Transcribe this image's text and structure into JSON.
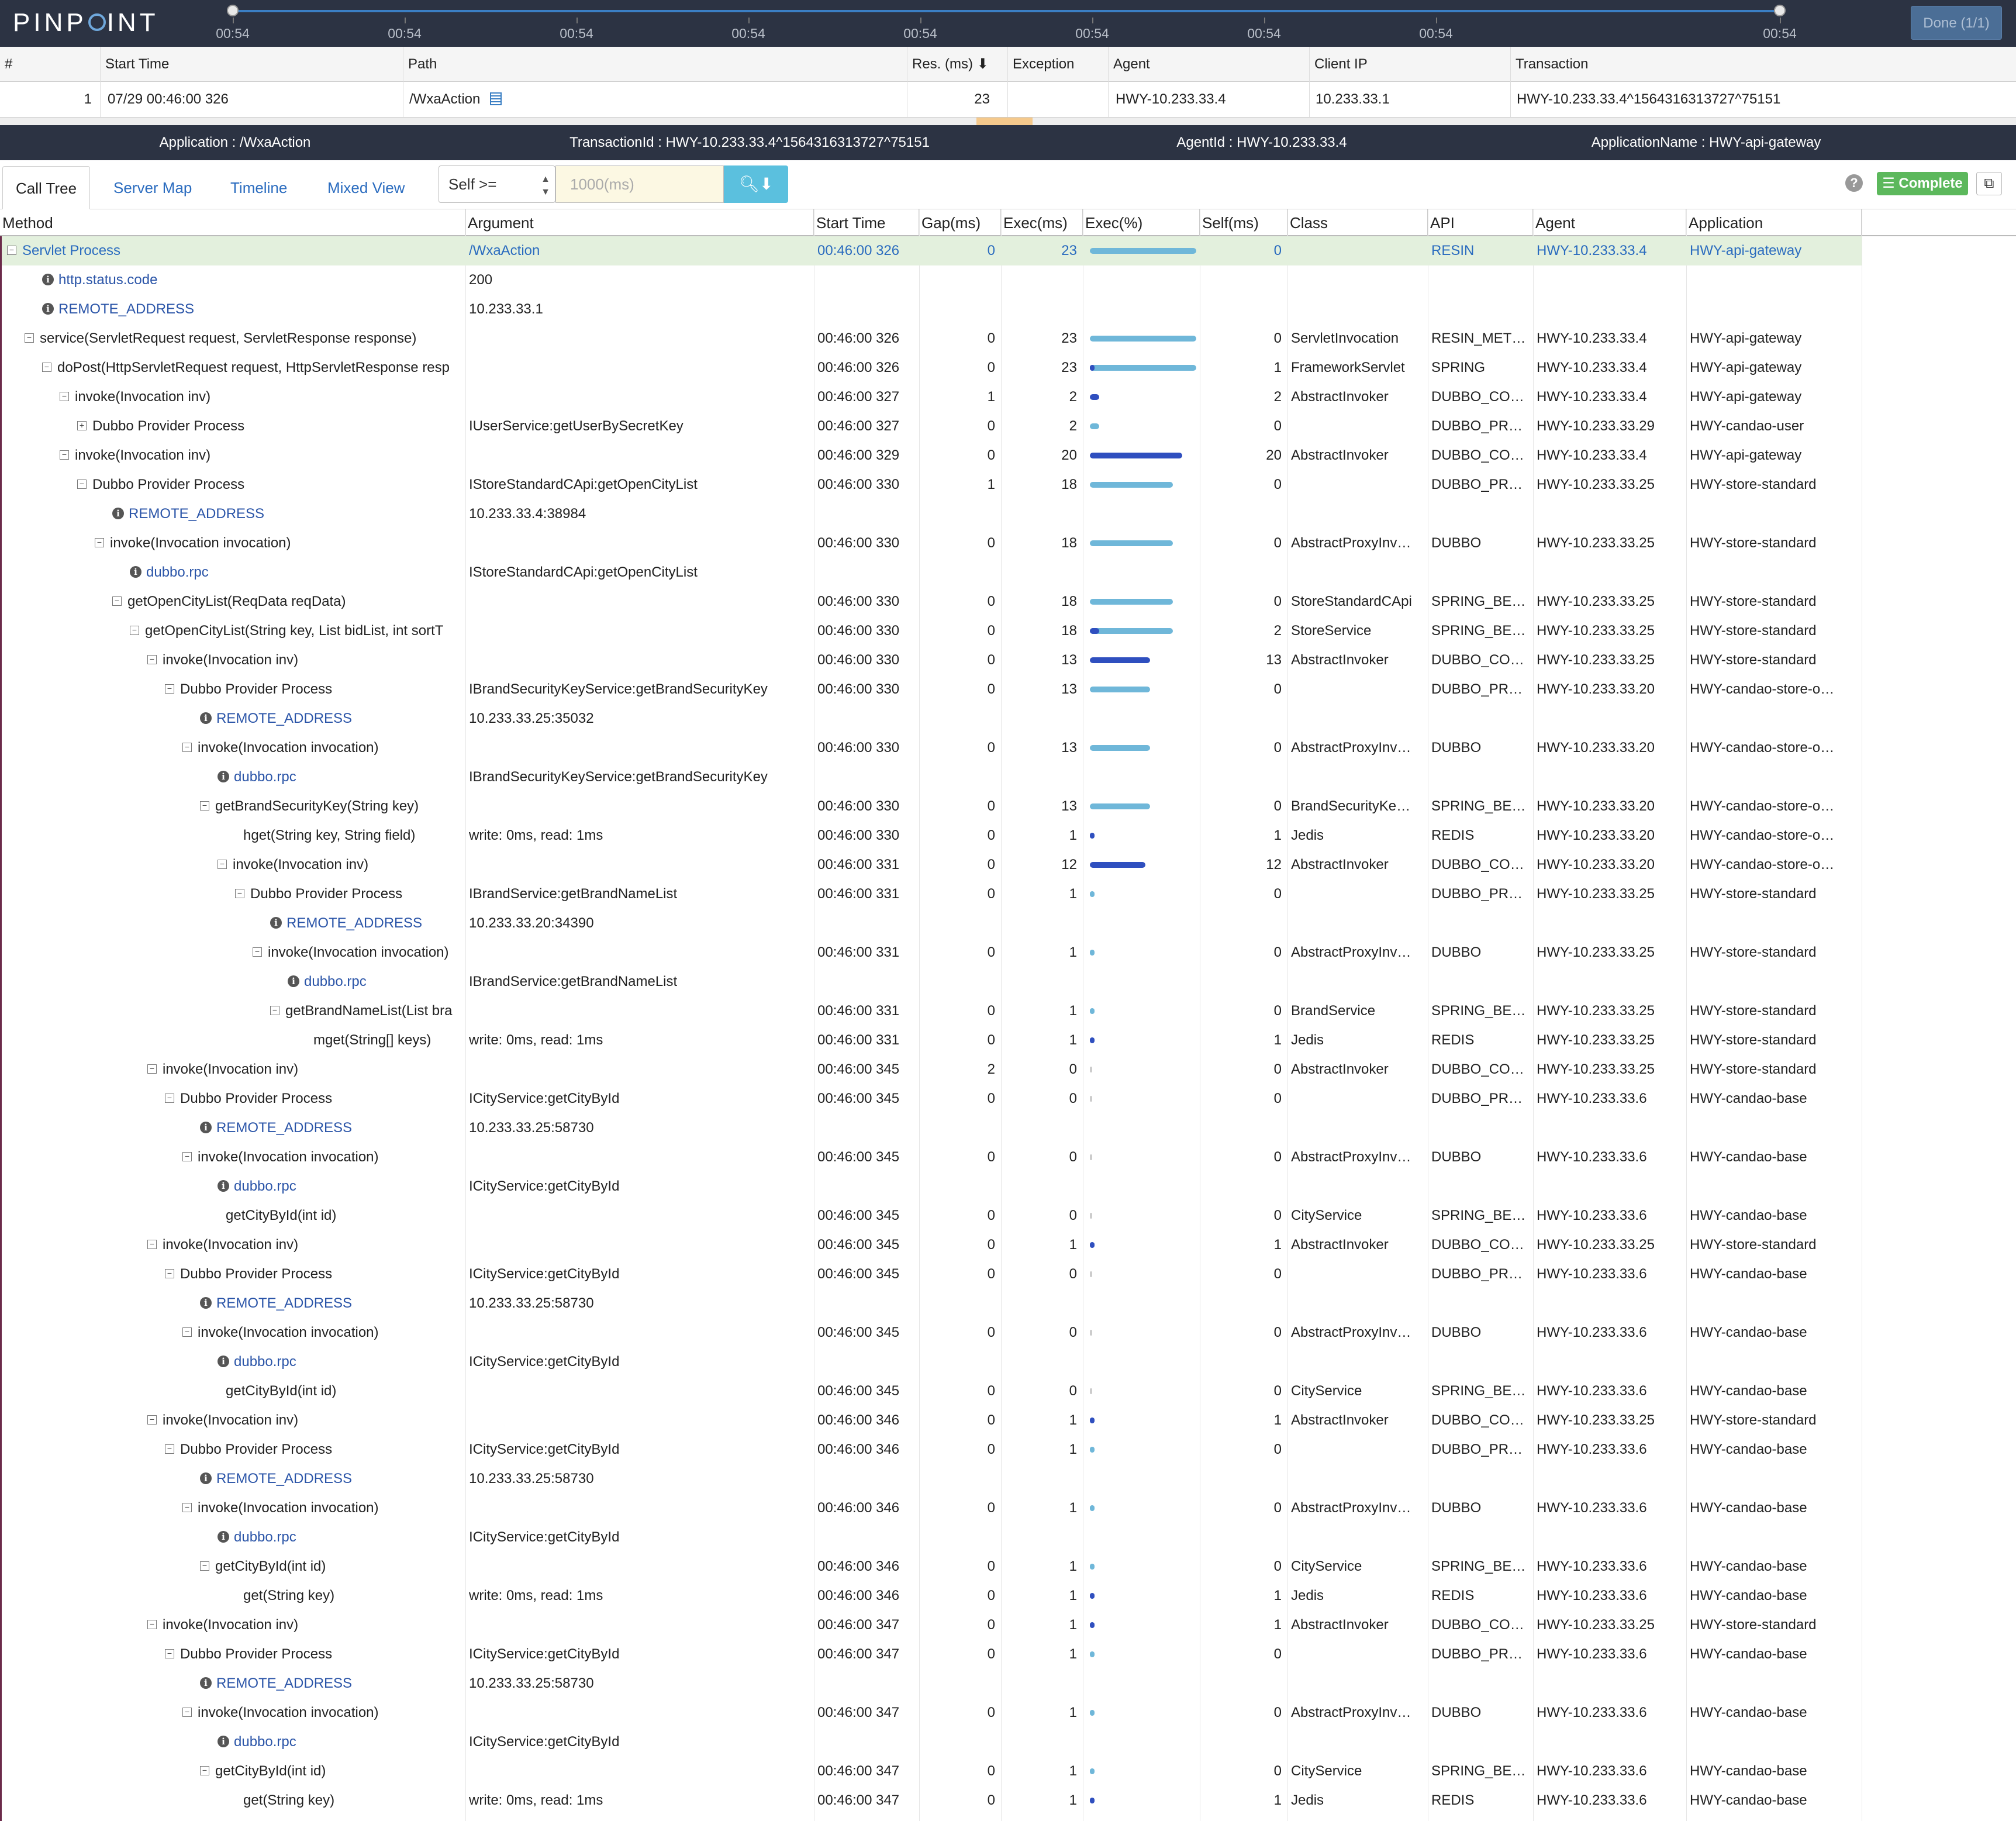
{
  "app": {
    "logo": "PINPOINT",
    "done_label": "Done (1/1)"
  },
  "timeline": {
    "labels": [
      "00:54",
      "00:54",
      "00:54",
      "00:54",
      "00:54",
      "00:54",
      "00:54",
      "00:54",
      "00:54"
    ]
  },
  "transactions": {
    "headers": [
      "#",
      "Start Time",
      "Path",
      "Res. (ms) ⬇",
      "Exception",
      "Agent",
      "Client IP",
      "Transaction"
    ],
    "rows": [
      [
        "1",
        "07/29 00:46:00 326",
        "/WxaAction",
        "23",
        "",
        "HWY-10.233.33.4",
        "10.233.33.1",
        "HWY-10.233.33.4^1564316313727^75151"
      ]
    ]
  },
  "info": {
    "application": "Application : /WxaAction",
    "transaction_id": "TransactionId : HWY-10.233.33.4^1564316313727^75151",
    "agent_id": "AgentId : HWY-10.233.33.4",
    "application_name": "ApplicationName : HWY-api-gateway"
  },
  "tabs": [
    "Call Tree",
    "Server Map",
    "Timeline",
    "Mixed View"
  ],
  "filter": {
    "select_value": "Self >=",
    "input_placeholder": "1000(ms)"
  },
  "toolbar": {
    "help": "?",
    "complete_label": "Complete"
  },
  "calltree": {
    "headers": [
      "Method",
      "Argument",
      "Start Time",
      "Gap(ms)",
      "Exec(ms)",
      "Exec(%)",
      "Self(ms)",
      "Class",
      "API",
      "Agent",
      "Application"
    ],
    "rows": [
      {
        "m": "Servlet Process",
        "a": "/WxaAction",
        "t": "00:46:00 326",
        "g": "0",
        "e": "23",
        "s": "0",
        "c": "",
        "api": "RESIN",
        "ag": "HWY-10.233.33.4",
        "app": "HWY-api-gateway"
      },
      {
        "m": "http.status.code",
        "a": "200",
        "t": "",
        "g": "",
        "e": "",
        "s": "",
        "c": "",
        "api": "",
        "ag": "",
        "app": ""
      },
      {
        "m": "REMOTE_ADDRESS",
        "a": "10.233.33.1",
        "t": "",
        "g": "",
        "e": "",
        "s": "",
        "c": "",
        "api": "",
        "ag": "",
        "app": ""
      },
      {
        "m": "service(ServletRequest request, ServletResponse response)",
        "a": "",
        "t": "00:46:00 326",
        "g": "0",
        "e": "23",
        "s": "0",
        "c": "ServletInvocation",
        "api": "RESIN_MET…",
        "ag": "HWY-10.233.33.4",
        "app": "HWY-api-gateway"
      },
      {
        "m": "doPost(HttpServletRequest request, HttpServletResponse resp",
        "a": "",
        "t": "00:46:00 326",
        "g": "0",
        "e": "23",
        "s": "1",
        "c": "FrameworkServlet",
        "api": "SPRING",
        "ag": "HWY-10.233.33.4",
        "app": "HWY-api-gateway"
      },
      {
        "m": "invoke(Invocation inv)",
        "a": "",
        "t": "00:46:00 327",
        "g": "1",
        "e": "2",
        "s": "2",
        "c": "AbstractInvoker",
        "api": "DUBBO_CO…",
        "ag": "HWY-10.233.33.4",
        "app": "HWY-api-gateway"
      },
      {
        "m": "Dubbo Provider Process",
        "a": "IUserService:getUserBySecretKey",
        "t": "00:46:00 327",
        "g": "0",
        "e": "2",
        "s": "0",
        "c": "",
        "api": "DUBBO_PR…",
        "ag": "HWY-10.233.33.29",
        "app": "HWY-candao-user"
      },
      {
        "m": "invoke(Invocation inv)",
        "a": "",
        "t": "00:46:00 329",
        "g": "0",
        "e": "20",
        "s": "20",
        "c": "AbstractInvoker",
        "api": "DUBBO_CO…",
        "ag": "HWY-10.233.33.4",
        "app": "HWY-api-gateway"
      },
      {
        "m": "Dubbo Provider Process",
        "a": "IStoreStandardCApi:getOpenCityList",
        "t": "00:46:00 330",
        "g": "1",
        "e": "18",
        "s": "0",
        "c": "",
        "api": "DUBBO_PR…",
        "ag": "HWY-10.233.33.25",
        "app": "HWY-store-standard"
      },
      {
        "m": "REMOTE_ADDRESS",
        "a": "10.233.33.4:38984",
        "t": "",
        "g": "",
        "e": "",
        "s": "",
        "c": "",
        "api": "",
        "ag": "",
        "app": ""
      },
      {
        "m": "invoke(Invocation invocation)",
        "a": "",
        "t": "00:46:00 330",
        "g": "0",
        "e": "18",
        "s": "0",
        "c": "AbstractProxyInv…",
        "api": "DUBBO",
        "ag": "HWY-10.233.33.25",
        "app": "HWY-store-standard"
      },
      {
        "m": "dubbo.rpc",
        "a": "IStoreStandardCApi:getOpenCityList",
        "t": "",
        "g": "",
        "e": "",
        "s": "",
        "c": "",
        "api": "",
        "ag": "",
        "app": ""
      },
      {
        "m": "getOpenCityList(ReqData reqData)",
        "a": "",
        "t": "00:46:00 330",
        "g": "0",
        "e": "18",
        "s": "0",
        "c": "StoreStandardCApi",
        "api": "SPRING_BE…",
        "ag": "HWY-10.233.33.25",
        "app": "HWY-store-standard"
      },
      {
        "m": "getOpenCityList(String key, List bidList, int sortT",
        "a": "",
        "t": "00:46:00 330",
        "g": "0",
        "e": "18",
        "s": "2",
        "c": "StoreService",
        "api": "SPRING_BE…",
        "ag": "HWY-10.233.33.25",
        "app": "HWY-store-standard"
      },
      {
        "m": "invoke(Invocation inv)",
        "a": "",
        "t": "00:46:00 330",
        "g": "0",
        "e": "13",
        "s": "13",
        "c": "AbstractInvoker",
        "api": "DUBBO_CO…",
        "ag": "HWY-10.233.33.25",
        "app": "HWY-store-standard"
      },
      {
        "m": "Dubbo Provider Process",
        "a": "IBrandSecurityKeyService:getBrandSecurityKey",
        "t": "00:46:00 330",
        "g": "0",
        "e": "13",
        "s": "0",
        "c": "",
        "api": "DUBBO_PR…",
        "ag": "HWY-10.233.33.20",
        "app": "HWY-candao-store-o…"
      },
      {
        "m": "REMOTE_ADDRESS",
        "a": "10.233.33.25:35032",
        "t": "",
        "g": "",
        "e": "",
        "s": "",
        "c": "",
        "api": "",
        "ag": "",
        "app": ""
      },
      {
        "m": "invoke(Invocation invocation)",
        "a": "",
        "t": "00:46:00 330",
        "g": "0",
        "e": "13",
        "s": "0",
        "c": "AbstractProxyInv…",
        "api": "DUBBO",
        "ag": "HWY-10.233.33.20",
        "app": "HWY-candao-store-o…"
      },
      {
        "m": "dubbo.rpc",
        "a": "IBrandSecurityKeyService:getBrandSecurityKey",
        "t": "",
        "g": "",
        "e": "",
        "s": "",
        "c": "",
        "api": "",
        "ag": "",
        "app": ""
      },
      {
        "m": "getBrandSecurityKey(String key)",
        "a": "",
        "t": "00:46:00 330",
        "g": "0",
        "e": "13",
        "s": "0",
        "c": "BrandSecurityKe…",
        "api": "SPRING_BE…",
        "ag": "HWY-10.233.33.20",
        "app": "HWY-candao-store-o…"
      },
      {
        "m": "hget(String key, String field)",
        "a": "write: 0ms, read: 1ms",
        "t": "00:46:00 330",
        "g": "0",
        "e": "1",
        "s": "1",
        "c": "Jedis",
        "api": "REDIS",
        "ag": "HWY-10.233.33.20",
        "app": "HWY-candao-store-o…"
      },
      {
        "m": "invoke(Invocation inv)",
        "a": "",
        "t": "00:46:00 331",
        "g": "0",
        "e": "12",
        "s": "12",
        "c": "AbstractInvoker",
        "api": "DUBBO_CO…",
        "ag": "HWY-10.233.33.20",
        "app": "HWY-candao-store-o…"
      },
      {
        "m": "Dubbo Provider Process",
        "a": "IBrandService:getBrandNameList",
        "t": "00:46:00 331",
        "g": "0",
        "e": "1",
        "s": "0",
        "c": "",
        "api": "DUBBO_PR…",
        "ag": "HWY-10.233.33.25",
        "app": "HWY-store-standard"
      },
      {
        "m": "REMOTE_ADDRESS",
        "a": "10.233.33.20:34390",
        "t": "",
        "g": "",
        "e": "",
        "s": "",
        "c": "",
        "api": "",
        "ag": "",
        "app": ""
      },
      {
        "m": "invoke(Invocation invocation)",
        "a": "",
        "t": "00:46:00 331",
        "g": "0",
        "e": "1",
        "s": "0",
        "c": "AbstractProxyInv…",
        "api": "DUBBO",
        "ag": "HWY-10.233.33.25",
        "app": "HWY-store-standard"
      },
      {
        "m": "dubbo.rpc",
        "a": "IBrandService:getBrandNameList",
        "t": "",
        "g": "",
        "e": "",
        "s": "",
        "c": "",
        "api": "",
        "ag": "",
        "app": ""
      },
      {
        "m": "getBrandNameList(List bra",
        "a": "",
        "t": "00:46:00 331",
        "g": "0",
        "e": "1",
        "s": "0",
        "c": "BrandService",
        "api": "SPRING_BE…",
        "ag": "HWY-10.233.33.25",
        "app": "HWY-store-standard"
      },
      {
        "m": "mget(String[] keys)",
        "a": "write: 0ms, read: 1ms",
        "t": "00:46:00 331",
        "g": "0",
        "e": "1",
        "s": "1",
        "c": "Jedis",
        "api": "REDIS",
        "ag": "HWY-10.233.33.25",
        "app": "HWY-store-standard"
      },
      {
        "m": "invoke(Invocation inv)",
        "a": "",
        "t": "00:46:00 345",
        "g": "2",
        "e": "0",
        "s": "0",
        "c": "AbstractInvoker",
        "api": "DUBBO_CO…",
        "ag": "HWY-10.233.33.25",
        "app": "HWY-store-standard"
      },
      {
        "m": "Dubbo Provider Process",
        "a": "ICityService:getCityById",
        "t": "00:46:00 345",
        "g": "0",
        "e": "0",
        "s": "0",
        "c": "",
        "api": "DUBBO_PR…",
        "ag": "HWY-10.233.33.6",
        "app": "HWY-candao-base"
      },
      {
        "m": "REMOTE_ADDRESS",
        "a": "10.233.33.25:58730",
        "t": "",
        "g": "",
        "e": "",
        "s": "",
        "c": "",
        "api": "",
        "ag": "",
        "app": ""
      },
      {
        "m": "invoke(Invocation invocation)",
        "a": "",
        "t": "00:46:00 345",
        "g": "0",
        "e": "0",
        "s": "0",
        "c": "AbstractProxyInv…",
        "api": "DUBBO",
        "ag": "HWY-10.233.33.6",
        "app": "HWY-candao-base"
      },
      {
        "m": "dubbo.rpc",
        "a": "ICityService:getCityById",
        "t": "",
        "g": "",
        "e": "",
        "s": "",
        "c": "",
        "api": "",
        "ag": "",
        "app": ""
      },
      {
        "m": "getCityById(int id)",
        "a": "",
        "t": "00:46:00 345",
        "g": "0",
        "e": "0",
        "s": "0",
        "c": "CityService",
        "api": "SPRING_BE…",
        "ag": "HWY-10.233.33.6",
        "app": "HWY-candao-base"
      },
      {
        "m": "invoke(Invocation inv)",
        "a": "",
        "t": "00:46:00 345",
        "g": "0",
        "e": "1",
        "s": "1",
        "c": "AbstractInvoker",
        "api": "DUBBO_CO…",
        "ag": "HWY-10.233.33.25",
        "app": "HWY-store-standard"
      },
      {
        "m": "Dubbo Provider Process",
        "a": "ICityService:getCityById",
        "t": "00:46:00 345",
        "g": "0",
        "e": "0",
        "s": "0",
        "c": "",
        "api": "DUBBO_PR…",
        "ag": "HWY-10.233.33.6",
        "app": "HWY-candao-base"
      },
      {
        "m": "REMOTE_ADDRESS",
        "a": "10.233.33.25:58730",
        "t": "",
        "g": "",
        "e": "",
        "s": "",
        "c": "",
        "api": "",
        "ag": "",
        "app": ""
      },
      {
        "m": "invoke(Invocation invocation)",
        "a": "",
        "t": "00:46:00 345",
        "g": "0",
        "e": "0",
        "s": "0",
        "c": "AbstractProxyInv…",
        "api": "DUBBO",
        "ag": "HWY-10.233.33.6",
        "app": "HWY-candao-base"
      },
      {
        "m": "dubbo.rpc",
        "a": "ICityService:getCityById",
        "t": "",
        "g": "",
        "e": "",
        "s": "",
        "c": "",
        "api": "",
        "ag": "",
        "app": ""
      },
      {
        "m": "getCityById(int id)",
        "a": "",
        "t": "00:46:00 345",
        "g": "0",
        "e": "0",
        "s": "0",
        "c": "CityService",
        "api": "SPRING_BE…",
        "ag": "HWY-10.233.33.6",
        "app": "HWY-candao-base"
      },
      {
        "m": "invoke(Invocation inv)",
        "a": "",
        "t": "00:46:00 346",
        "g": "0",
        "e": "1",
        "s": "1",
        "c": "AbstractInvoker",
        "api": "DUBBO_CO…",
        "ag": "HWY-10.233.33.25",
        "app": "HWY-store-standard"
      },
      {
        "m": "Dubbo Provider Process",
        "a": "ICityService:getCityById",
        "t": "00:46:00 346",
        "g": "0",
        "e": "1",
        "s": "0",
        "c": "",
        "api": "DUBBO_PR…",
        "ag": "HWY-10.233.33.6",
        "app": "HWY-candao-base"
      },
      {
        "m": "REMOTE_ADDRESS",
        "a": "10.233.33.25:58730",
        "t": "",
        "g": "",
        "e": "",
        "s": "",
        "c": "",
        "api": "",
        "ag": "",
        "app": ""
      },
      {
        "m": "invoke(Invocation invocation)",
        "a": "",
        "t": "00:46:00 346",
        "g": "0",
        "e": "1",
        "s": "0",
        "c": "AbstractProxyInv…",
        "api": "DUBBO",
        "ag": "HWY-10.233.33.6",
        "app": "HWY-candao-base"
      },
      {
        "m": "dubbo.rpc",
        "a": "ICityService:getCityById",
        "t": "",
        "g": "",
        "e": "",
        "s": "",
        "c": "",
        "api": "",
        "ag": "",
        "app": ""
      },
      {
        "m": "getCityById(int id)",
        "a": "",
        "t": "00:46:00 346",
        "g": "0",
        "e": "1",
        "s": "0",
        "c": "CityService",
        "api": "SPRING_BE…",
        "ag": "HWY-10.233.33.6",
        "app": "HWY-candao-base"
      },
      {
        "m": "get(String key)",
        "a": "write: 0ms, read: 1ms",
        "t": "00:46:00 346",
        "g": "0",
        "e": "1",
        "s": "1",
        "c": "Jedis",
        "api": "REDIS",
        "ag": "HWY-10.233.33.6",
        "app": "HWY-candao-base"
      },
      {
        "m": "invoke(Invocation inv)",
        "a": "",
        "t": "00:46:00 347",
        "g": "0",
        "e": "1",
        "s": "1",
        "c": "AbstractInvoker",
        "api": "DUBBO_CO…",
        "ag": "HWY-10.233.33.25",
        "app": "HWY-store-standard"
      },
      {
        "m": "Dubbo Provider Process",
        "a": "ICityService:getCityById",
        "t": "00:46:00 347",
        "g": "0",
        "e": "1",
        "s": "0",
        "c": "",
        "api": "DUBBO_PR…",
        "ag": "HWY-10.233.33.6",
        "app": "HWY-candao-base"
      },
      {
        "m": "REMOTE_ADDRESS",
        "a": "10.233.33.25:58730",
        "t": "",
        "g": "",
        "e": "",
        "s": "",
        "c": "",
        "api": "",
        "ag": "",
        "app": ""
      },
      {
        "m": "invoke(Invocation invocation)",
        "a": "",
        "t": "00:46:00 347",
        "g": "0",
        "e": "1",
        "s": "0",
        "c": "AbstractProxyInv…",
        "api": "DUBBO",
        "ag": "HWY-10.233.33.6",
        "app": "HWY-candao-base"
      },
      {
        "m": "dubbo.rpc",
        "a": "ICityService:getCityById",
        "t": "",
        "g": "",
        "e": "",
        "s": "",
        "c": "",
        "api": "",
        "ag": "",
        "app": ""
      },
      {
        "m": "getCityById(int id)",
        "a": "",
        "t": "00:46:00 347",
        "g": "0",
        "e": "1",
        "s": "0",
        "c": "CityService",
        "api": "SPRING_BE…",
        "ag": "HWY-10.233.33.6",
        "app": "HWY-candao-base"
      },
      {
        "m": "get(String key)",
        "a": "write: 0ms, read: 1ms",
        "t": "00:46:00 347",
        "g": "0",
        "e": "1",
        "s": "1",
        "c": "Jedis",
        "api": "REDIS",
        "ag": "HWY-10.233.33.6",
        "app": "HWY-candao-base"
      }
    ]
  }
}
